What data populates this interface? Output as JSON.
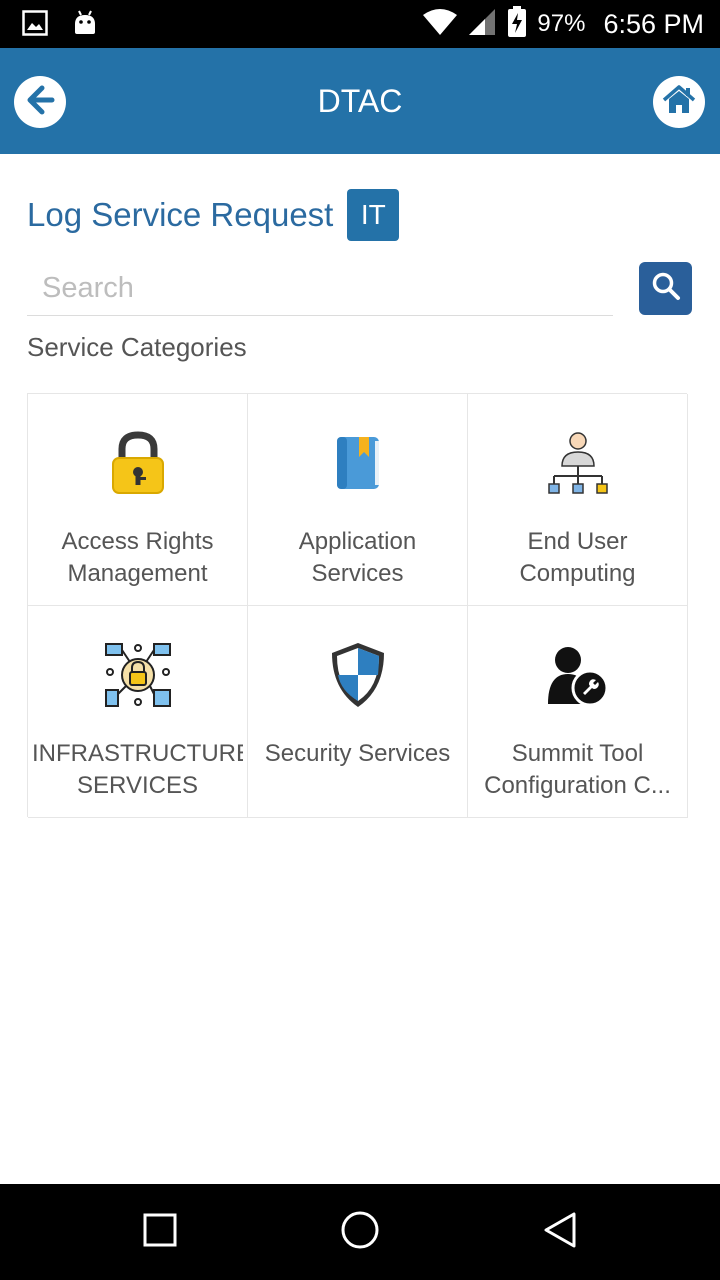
{
  "status_bar": {
    "battery_percent": "97%",
    "time": "6:56 PM",
    "icons": [
      "gallery-icon",
      "android-icon",
      "wifi-icon",
      "signal-icon",
      "battery-charging-icon"
    ]
  },
  "app_bar": {
    "title": "DTAC",
    "back_icon": "back-arrow-icon",
    "home_icon": "home-icon",
    "color": "#2472a8"
  },
  "heading": {
    "title": "Log Service Request",
    "badge": "IT"
  },
  "search": {
    "placeholder": "Search",
    "value": "",
    "button_icon": "search-icon"
  },
  "section_label": "Service Categories",
  "categories": [
    {
      "label": "Access Rights Management",
      "icon": "padlock-icon"
    },
    {
      "label": "Application Services",
      "icon": "book-icon"
    },
    {
      "label": "End User Computing",
      "icon": "user-hierarchy-icon"
    },
    {
      "label": "INFRASTRUCTURE SERVICES",
      "icon": "network-security-icon"
    },
    {
      "label": "Security Services",
      "icon": "shield-icon"
    },
    {
      "label": "Summit Tool Configuration C...",
      "icon": "user-settings-icon"
    }
  ],
  "nav_bar": {
    "buttons": [
      "recents-square-icon",
      "home-circle-icon",
      "back-triangle-icon"
    ]
  }
}
